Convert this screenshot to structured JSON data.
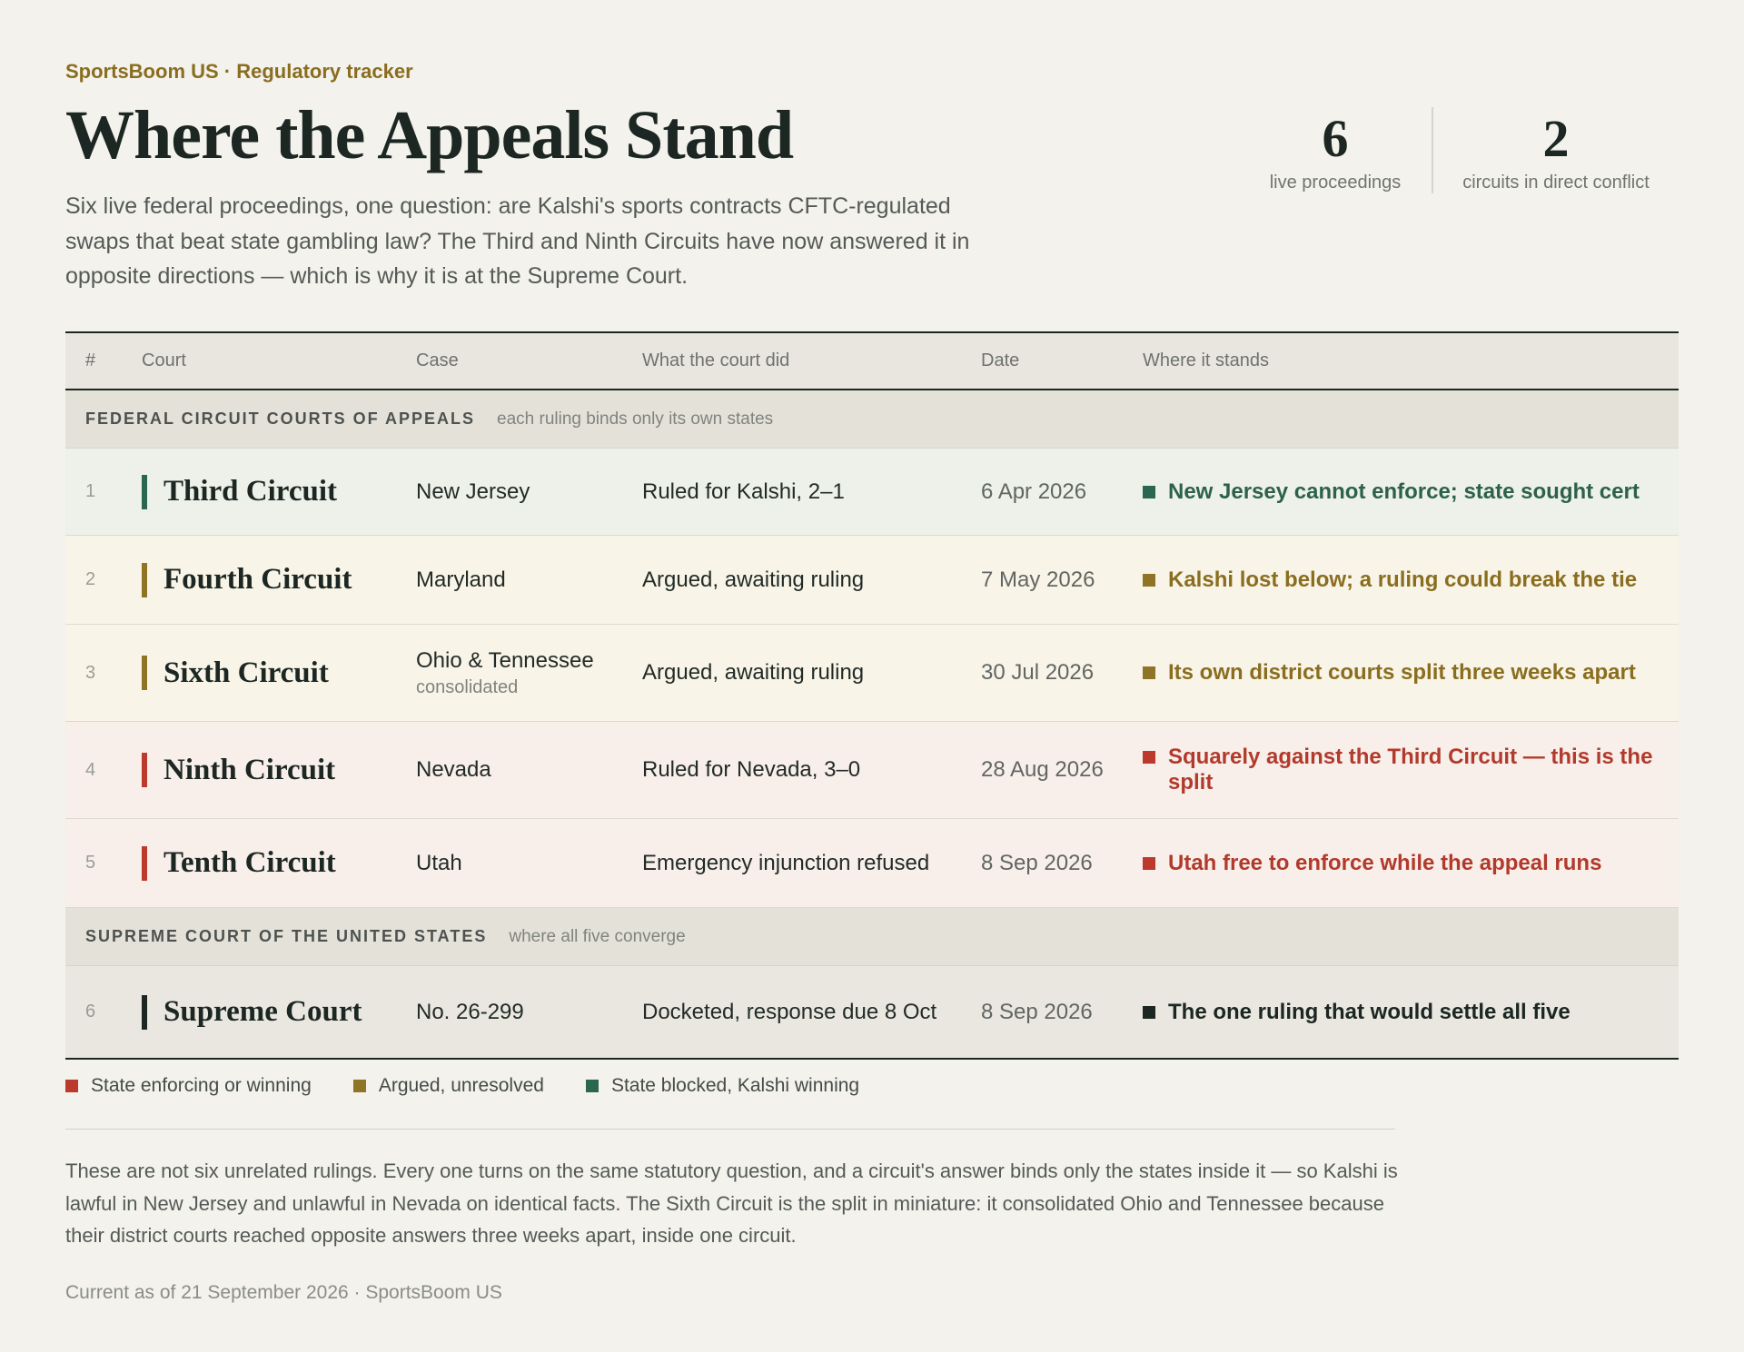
{
  "kicker": "SportsBoom US · Regulatory tracker",
  "title": "Where the Appeals Stand",
  "lede": "Six live federal proceedings, one question: are Kalshi's sports contracts CFTC-regulated swaps that beat state gambling law? The Third and Ninth Circuits have now answered it in opposite directions — which is why it is at the Supreme Court.",
  "stats": [
    {
      "value": "6",
      "label": "live proceedings"
    },
    {
      "value": "2",
      "label": "circuits in direct conflict"
    }
  ],
  "table": {
    "headers": {
      "num": "#",
      "court": "Court",
      "case": "Case",
      "did": "What the court did",
      "date": "Date",
      "stands": "Where it stands"
    },
    "groups": [
      {
        "title": "FEDERAL CIRCUIT COURTS OF APPEALS",
        "note": "each ruling binds only its own states",
        "rows": [
          {
            "num": "1",
            "court": "Third Circuit",
            "case": "New Jersey",
            "case_sub": "",
            "did": "Ruled for Kalshi, 2–1",
            "date": "6 Apr 2026",
            "stands": "New Jersey cannot enforce; state sought cert",
            "status": "green"
          },
          {
            "num": "2",
            "court": "Fourth Circuit",
            "case": "Maryland",
            "case_sub": "",
            "did": "Argued, awaiting ruling",
            "date": "7 May 2026",
            "stands": "Kalshi lost below; a ruling could break the tie",
            "status": "gold"
          },
          {
            "num": "3",
            "court": "Sixth Circuit",
            "case": "Ohio & Tennessee",
            "case_sub": "consolidated",
            "did": "Argued, awaiting ruling",
            "date": "30 Jul 2026",
            "stands": "Its own district courts split three weeks apart",
            "status": "gold"
          },
          {
            "num": "4",
            "court": "Ninth Circuit",
            "case": "Nevada",
            "case_sub": "",
            "did": "Ruled for Nevada, 3–0",
            "date": "28 Aug 2026",
            "stands": "Squarely against the Third Circuit — this is the split",
            "status": "red"
          },
          {
            "num": "5",
            "court": "Tenth Circuit",
            "case": "Utah",
            "case_sub": "",
            "did": "Emergency injunction refused",
            "date": "8 Sep 2026",
            "stands": "Utah free to enforce while the appeal runs",
            "status": "red"
          }
        ]
      },
      {
        "title": "SUPREME COURT OF THE UNITED STATES",
        "note": "where all five converge",
        "rows": [
          {
            "num": "6",
            "court": "Supreme Court",
            "case": "No. 26-299",
            "case_sub": "",
            "did": "Docketed, response due 8 Oct",
            "date": "8 Sep 2026",
            "stands": "The one ruling that would settle all five",
            "status": "neutral"
          }
        ]
      }
    ]
  },
  "legend": [
    {
      "label": "State enforcing or winning",
      "color": "#bb3a2b"
    },
    {
      "label": "Argued, unresolved",
      "color": "#8f7426"
    },
    {
      "label": "State blocked, Kalshi winning",
      "color": "#2a6650"
    }
  ],
  "note": "These are not six unrelated rulings. Every one turns on the same statutory question, and a circuit's answer binds only the states inside it — so Kalshi is lawful in New Jersey and unlawful in Nevada on identical facts. The Sixth Circuit is the split in miniature: it consolidated Ohio and Tennessee because their district courts reached opposite answers three weeks apart, inside one circuit.",
  "footer": "Current as of 21 September 2026 · SportsBoom US",
  "colors": {
    "green": "#2a6650",
    "gold": "#8f7426",
    "red": "#bb3a2b",
    "dark": "#1c2622"
  }
}
